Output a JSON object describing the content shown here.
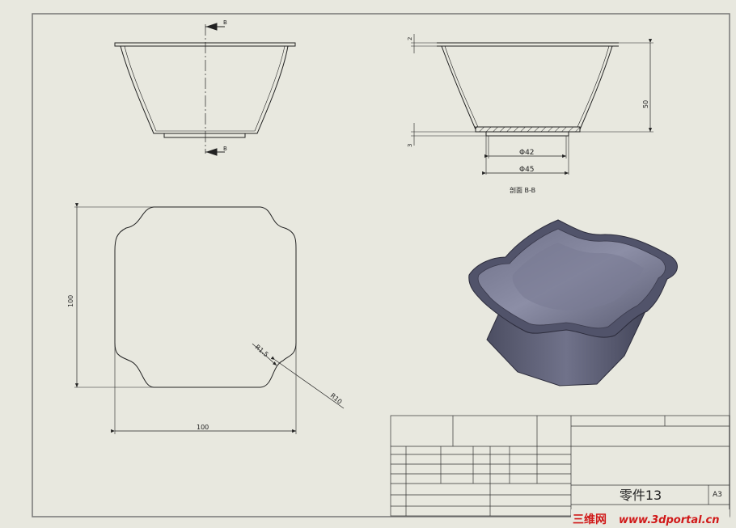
{
  "drawing": {
    "section_label": "B",
    "section_view_caption": "剖面 B-B",
    "dims": {
      "lip": "2",
      "depth": "50",
      "base": "3",
      "d_inner": "Φ42",
      "d_outer": "Φ45",
      "height": "100",
      "width": "100",
      "r_small": "R1.5",
      "r_large": "R10"
    }
  },
  "title_block": {
    "part_name": "零件13",
    "sheet_size": "A3"
  },
  "watermark": {
    "text_cn": "三维网",
    "text_url": "www.3dportal.cn"
  }
}
